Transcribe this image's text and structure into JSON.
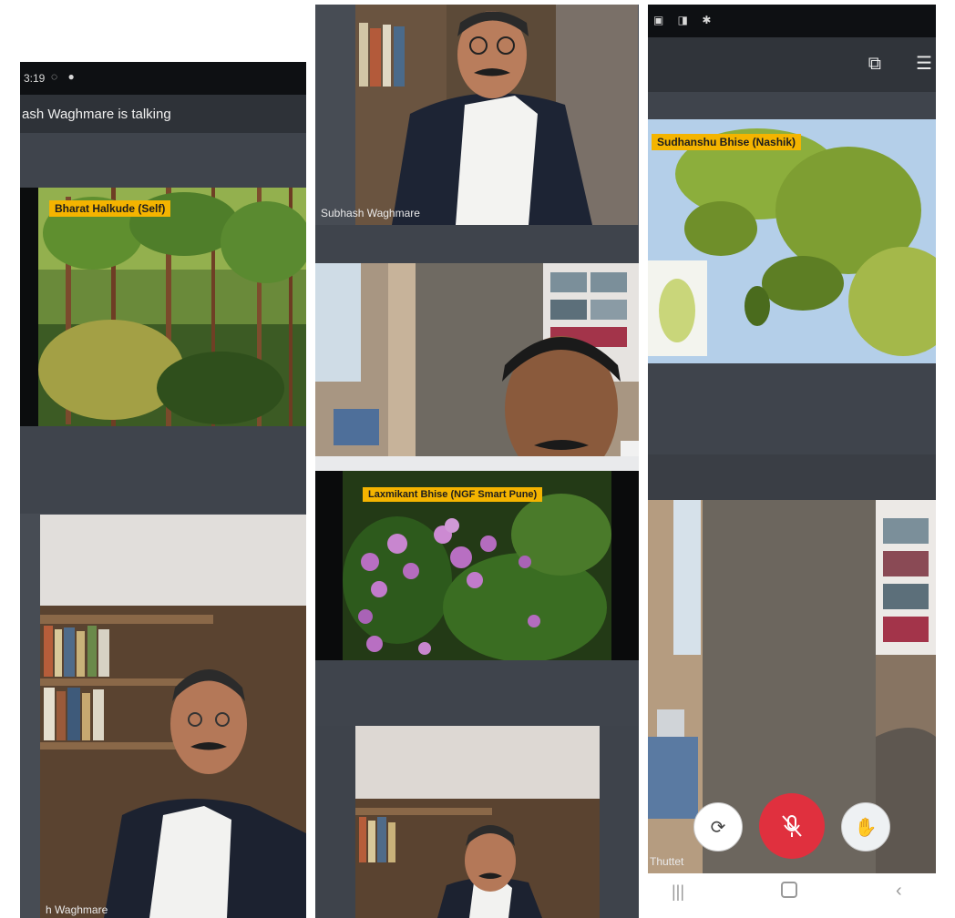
{
  "left_panel": {
    "status_time": "3:19",
    "header_text": "ash Waghmare is talking",
    "tile1_label": "Bharat Halkude (Self)",
    "tile2_label": "h Waghmare"
  },
  "middle_panel": {
    "tile1_label": "Subhash Waghmare",
    "tile3_label": "Laxmikant Bhise (NGF Smart Pune)"
  },
  "right_panel": {
    "tile1_label": "Sudhanshu Bhise (Nashik)",
    "tile2_label": "Thuttet"
  },
  "controls": {
    "camera_icon": "camera-switch-icon",
    "mic_icon": "mic-muted-icon",
    "end_icon": "hand-icon",
    "mic_color": "#e0303e"
  }
}
